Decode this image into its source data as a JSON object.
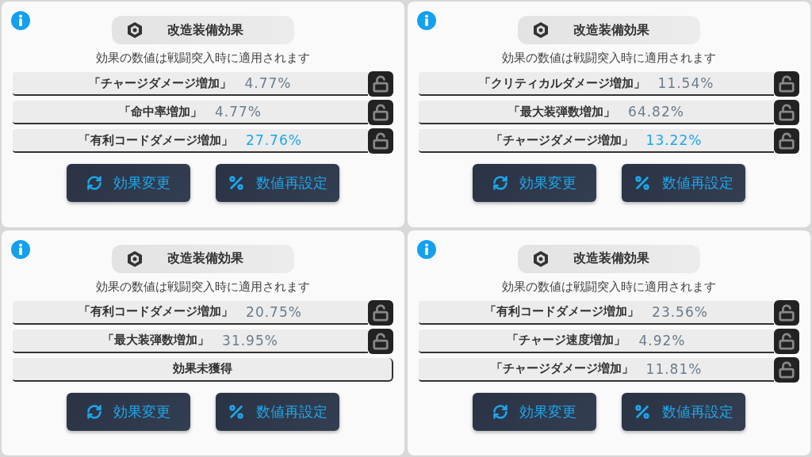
{
  "panels": [
    {
      "title": "改造装備効果",
      "note": "効果の数値は戦闘突入時に適用されます",
      "effects": [
        {
          "kind": "effect",
          "name": "「チャージダメージ増加」",
          "value": "4.77%",
          "highlight": false,
          "locked": false
        },
        {
          "kind": "effect",
          "name": "「命中率増加」",
          "value": "4.77%",
          "highlight": false,
          "locked": false
        },
        {
          "kind": "effect",
          "name": "「有利コードダメージ増加」",
          "value": "27.76%",
          "highlight": true,
          "locked": false
        }
      ],
      "buttons": [
        "効果変更",
        "数値再設定"
      ]
    },
    {
      "title": "改造装備効果",
      "note": "効果の数値は戦闘突入時に適用されます",
      "effects": [
        {
          "kind": "effect",
          "name": "「クリティカルダメージ増加」",
          "value": "11.54%",
          "highlight": false,
          "locked": false
        },
        {
          "kind": "effect",
          "name": "「最大装弾数増加」",
          "value": "64.82%",
          "highlight": false,
          "locked": false
        },
        {
          "kind": "effect",
          "name": "「チャージダメージ増加」",
          "value": "13.22%",
          "highlight": true,
          "locked": false
        }
      ],
      "buttons": [
        "効果変更",
        "数値再設定"
      ]
    },
    {
      "title": "改造装備効果",
      "note": "効果の数値は戦闘突入時に適用されます",
      "effects": [
        {
          "kind": "effect",
          "name": "「有利コードダメージ増加」",
          "value": "20.75%",
          "highlight": false,
          "locked": false
        },
        {
          "kind": "effect",
          "name": "「最大装弾数増加」",
          "value": "31.95%",
          "highlight": false,
          "locked": false
        },
        {
          "kind": "empty",
          "name": "効果未獲得"
        }
      ],
      "buttons": [
        "効果変更",
        "数値再設定"
      ]
    },
    {
      "title": "改造装備効果",
      "note": "効果の数値は戦闘突入時に適用されます",
      "effects": [
        {
          "kind": "effect",
          "name": "「有利コードダメージ増加」",
          "value": "23.56%",
          "highlight": false,
          "locked": false
        },
        {
          "kind": "effect",
          "name": "「チャージ速度増加」",
          "value": "4.92%",
          "highlight": false,
          "locked": false
        },
        {
          "kind": "effect",
          "name": "「チャージダメージ増加」",
          "value": "11.81%",
          "highlight": false,
          "locked": false
        }
      ],
      "buttons": [
        "効果変更",
        "数値再設定"
      ]
    }
  ]
}
